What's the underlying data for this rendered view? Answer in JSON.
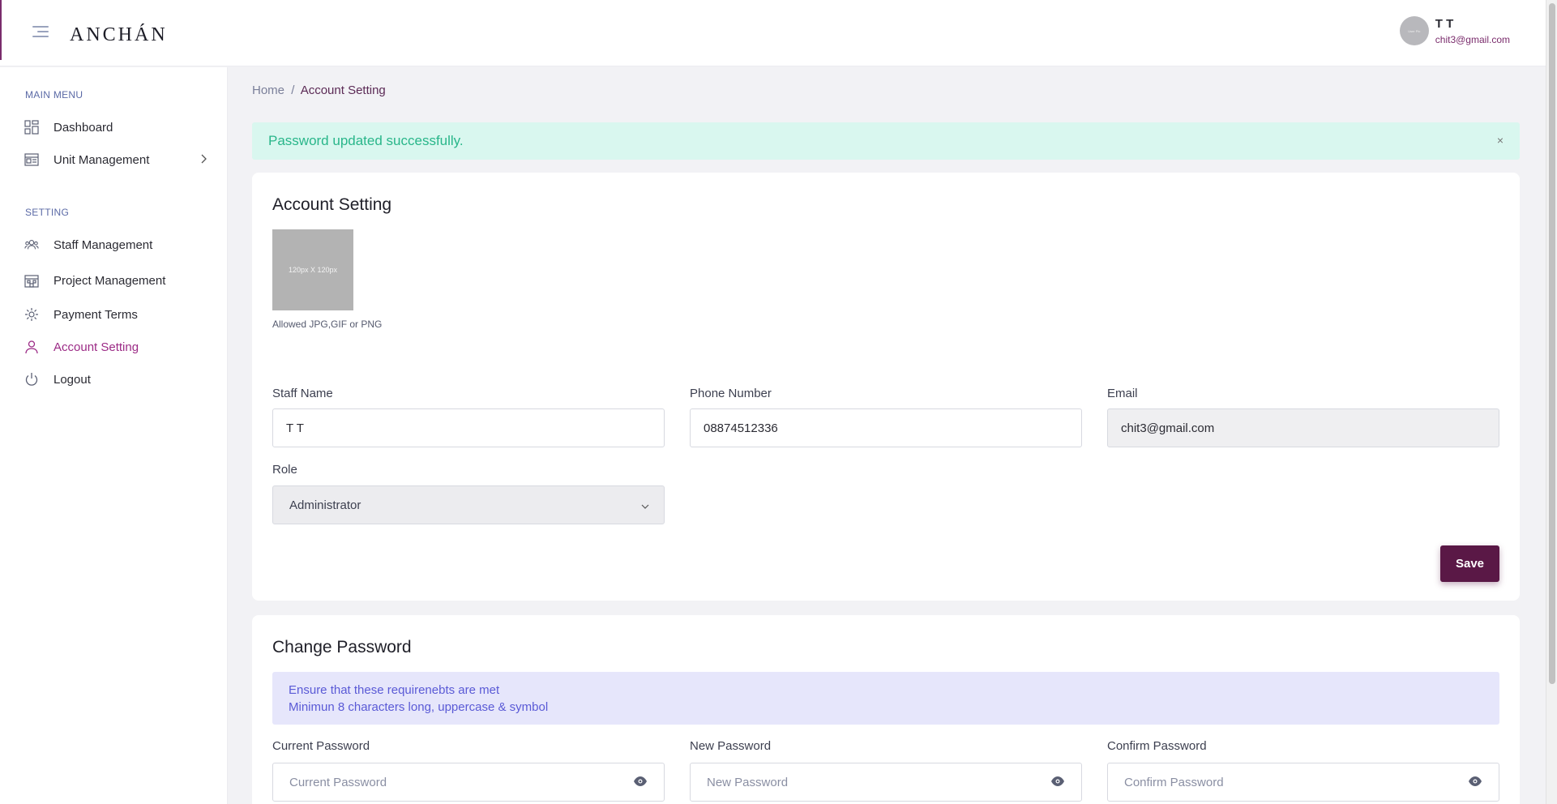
{
  "header": {
    "logo_text": "ANCHÁN",
    "menu_toggle_icon": "hamburger-icon",
    "user": {
      "name": "T T",
      "email": "chit3@gmail.com",
      "avatar_text": "User Pic"
    }
  },
  "sidebar": {
    "main_menu_label": "MAIN MENU",
    "setting_label": "SETTING",
    "main_items": [
      {
        "label": "Dashboard",
        "icon": "dashboard-icon"
      },
      {
        "label": "Unit Management",
        "icon": "unit-icon",
        "has_submenu": true
      }
    ],
    "setting_items": [
      {
        "label": "Staff Management",
        "icon": "people-icon"
      },
      {
        "label": "Project Management",
        "icon": "building-icon"
      },
      {
        "label": "Payment Terms",
        "icon": "gear-icon"
      },
      {
        "label": "Account Setting",
        "icon": "user-icon",
        "active": true
      },
      {
        "label": "Logout",
        "icon": "power-icon"
      }
    ]
  },
  "breadcrumb": {
    "home": "Home",
    "separator": "/",
    "current": "Account Setting"
  },
  "alert": {
    "message": "Password updated successfully.",
    "close": "×"
  },
  "account_card": {
    "title": "Account Setting",
    "photo_placeholder": "120px X 120px",
    "photo_hint": "Allowed JPG,GIF or PNG",
    "staff_name_label": "Staff Name",
    "staff_name_value": "T T",
    "phone_label": "Phone Number",
    "phone_value": "08874512336",
    "email_label": "Email",
    "email_value": "chit3@gmail.com",
    "role_label": "Role",
    "role_value": "Administrator",
    "save_label": "Save"
  },
  "password_card": {
    "title": "Change Password",
    "info_line1": "Ensure that these requirenebts are met",
    "info_line2": "Minimun 8 characters long, uppercase & symbol",
    "current_label": "Current Password",
    "current_placeholder": "Current Password",
    "new_label": "New Password",
    "new_placeholder": "New Password",
    "confirm_label": "Confirm Password",
    "confirm_placeholder": "Confirm Password"
  },
  "colors": {
    "accent": "#7a2c6c",
    "save_button": "#5a1846",
    "success_bg": "#d9f7ef",
    "success_text": "#29b68a",
    "info_bg": "#e6e6fb",
    "info_text": "#5a5ad6"
  }
}
